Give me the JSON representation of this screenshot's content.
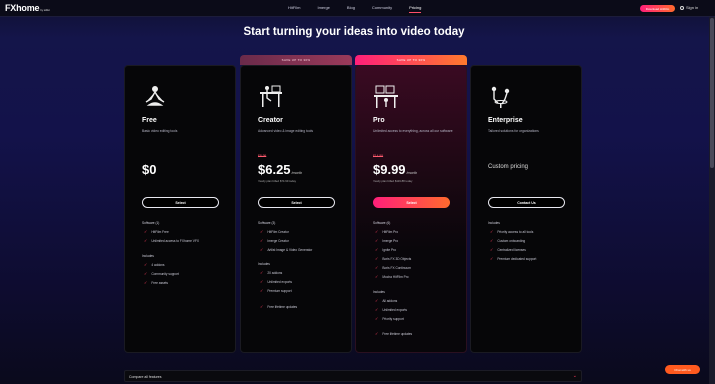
{
  "header": {
    "logo": "FXhome",
    "logo_sub": "by artlist",
    "nav": [
      "HitFilm",
      "Imerge",
      "Blog",
      "Community",
      "Pricing"
    ],
    "active_nav": "Pricing",
    "promo_label": "Download HitFilm",
    "signin_label": "Sign in"
  },
  "headline": "Start turning your ideas into video today",
  "badges": {
    "creator": "SAVE UP TO 30%",
    "pro": "SAVE UP TO 30%"
  },
  "plans": {
    "free": {
      "name": "Free",
      "icon": "meditating-person-icon",
      "desc": "Basic video editing tools",
      "price": "$0",
      "cta": "Select",
      "software_title": "Software (1)",
      "software": [
        "HitFilm Free",
        "Unlimited access to FXhome VFX"
      ],
      "includes_title": "Includes",
      "includes": [
        "4 addons",
        "Community support",
        "Free assets"
      ]
    },
    "creator": {
      "name": "Creator",
      "icon": "desk-worker-icon",
      "desc": "Advanced video & image editing tools",
      "old_price": "$8.99",
      "price": "$6.25",
      "price_unit": "/month",
      "price_note": "Yearly plan billed $74.99 today",
      "cta": "Select",
      "software_title": "Software (3)",
      "software": [
        "HitFilm Creator",
        "Imerge Creator",
        "Artlist Image & Video Generator"
      ],
      "includes_title": "Includes",
      "includes": [
        "20 addons",
        "Unlimited exports",
        "Premium support"
      ],
      "extra": "Free lifetime updates"
    },
    "pro": {
      "name": "Pro",
      "icon": "studio-desk-icon",
      "desc": "Unlimited access to everything, across all our software",
      "old_price": "$14.99",
      "price": "$9.99",
      "price_unit": "/month",
      "price_note": "Yearly plan billed $119.88 today",
      "cta": "Select",
      "software_title": "Software (6)",
      "software": [
        "HitFilm Pro",
        "Imerge Pro",
        "Ignite Pro",
        "Boris FX 3D Objects",
        "Boris FX Continuum",
        "Mocha HitFilm Pro"
      ],
      "includes_title": "Includes",
      "includes": [
        "All addons",
        "Unlimited exports",
        "Priority support"
      ],
      "extra": "Free lifetime updates"
    },
    "enterprise": {
      "name": "Enterprise",
      "icon": "team-meeting-icon",
      "desc": "Tailored solutions for organizations",
      "custom_pricing": "Custom pricing",
      "cta": "Contact Us",
      "includes_title": "Includes",
      "includes": [
        "Priority access to all tools",
        "Custom onboarding",
        "Centralized licenses",
        "Premium dedicated support"
      ]
    }
  },
  "compare_label": "Compare all features",
  "chat_label": "Chat with us",
  "colors": {
    "accent": "#ff3b5c",
    "gradient_start": "#ff1f7a",
    "gradient_end": "#ff6a2d"
  }
}
